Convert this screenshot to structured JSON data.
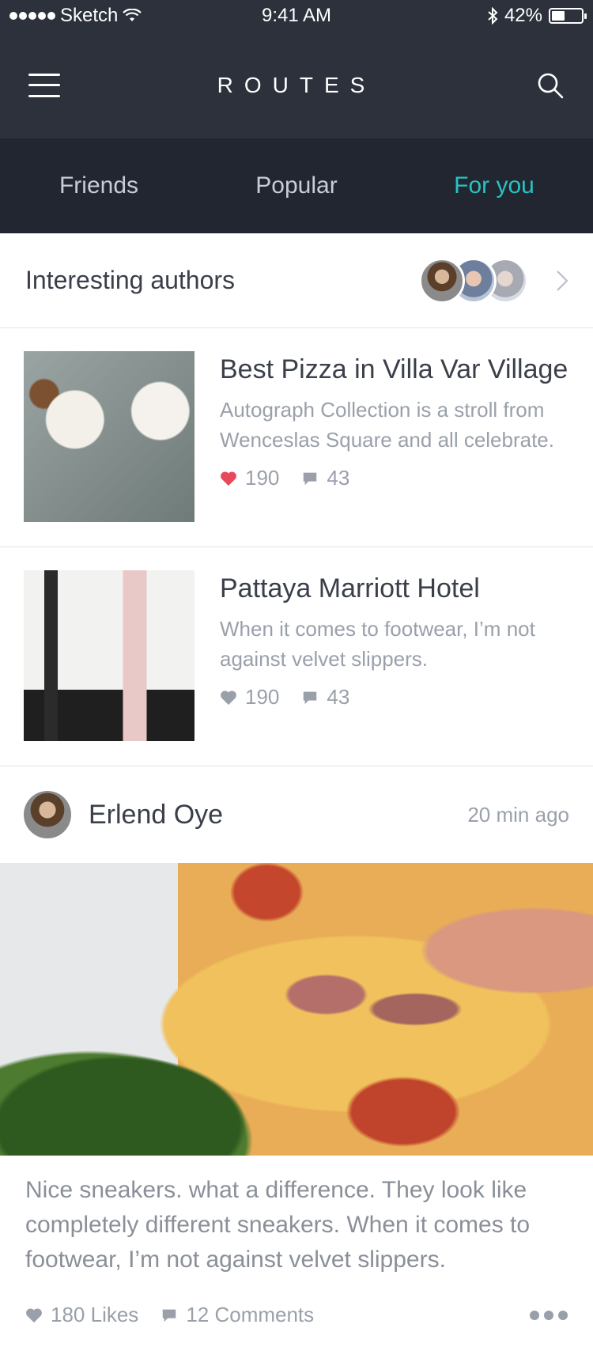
{
  "statusbar": {
    "carrier": "Sketch",
    "time": "9:41 AM",
    "battery": "42%"
  },
  "navbar": {
    "title": "ROUTES"
  },
  "tabs": [
    {
      "label": "Friends"
    },
    {
      "label": "Popular"
    },
    {
      "label": "For you"
    }
  ],
  "active_tab_color": "#27c3c1",
  "authors": {
    "title": "Interesting authors"
  },
  "items": [
    {
      "title": "Best Pizza in Villa Var Village",
      "desc": "Autograph Collection is a stroll from Wenceslas Square and all celebrate.",
      "likes": "190",
      "comments": "43",
      "liked": true
    },
    {
      "title": "Pattaya Marriott Hotel",
      "desc": "When it comes to footwear, I’m not against velvet slippers.",
      "likes": "190",
      "comments": "43",
      "liked": false
    }
  ],
  "post": {
    "author": "Erlend Oye",
    "time": "20 min ago",
    "text": "Nice sneakers. what a difference. They look like completely different sneakers. When it comes to footwear, I’m not against velvet slippers.",
    "likes": "180 Likes",
    "comments": "12 Comments"
  },
  "icons": {
    "menu": "hamburger-menu-icon",
    "search": "search-icon",
    "heart": "heart-icon",
    "comment": "comment-bubble-icon",
    "chevron": "chevron-right-icon",
    "more": "more-dots-icon"
  },
  "colors": {
    "nav_bg": "#2c313c",
    "tab_bg": "#222630",
    "like_red": "#e8485a",
    "muted": "#9aa0aa"
  }
}
